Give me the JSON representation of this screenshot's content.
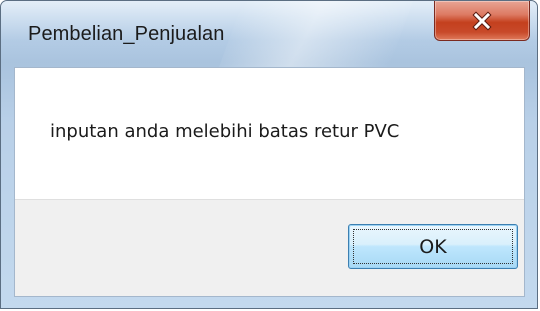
{
  "window": {
    "title": "Pembelian_Penjualan",
    "close_icon": "close-icon"
  },
  "dialog": {
    "message": "inputan anda melebihi batas retur PVC",
    "ok_label": "OK"
  },
  "colors": {
    "close_button": "#c84a2a",
    "ok_button_border": "#3c7fb1",
    "footer_background": "#f0f0f0"
  }
}
